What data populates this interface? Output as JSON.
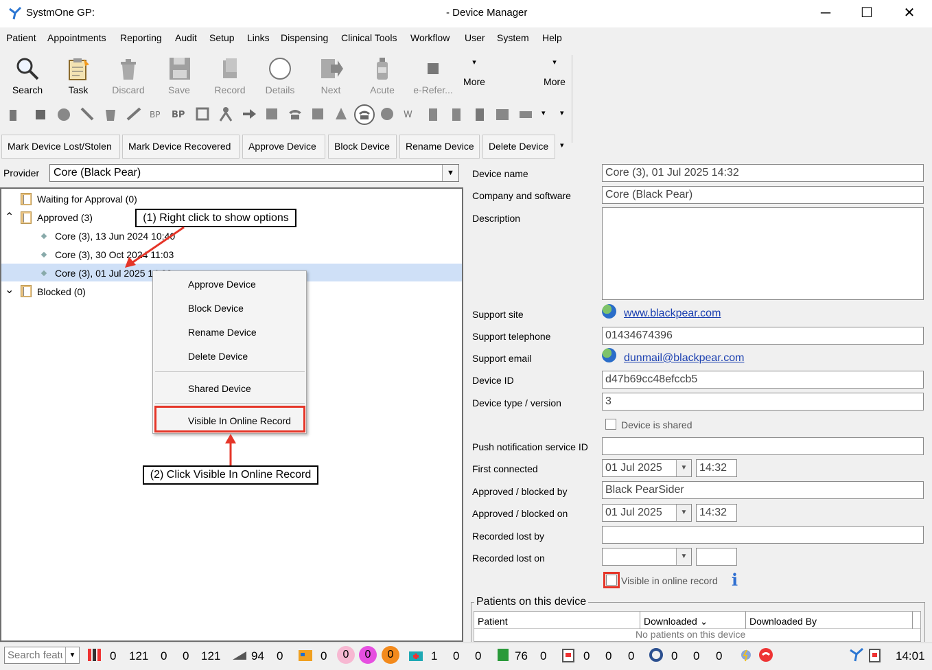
{
  "window": {
    "app_title": "SystmOne GP:",
    "doc_title": "- Device Manager",
    "minimize": "─",
    "maximize": "☐",
    "close": "✕"
  },
  "menu": [
    "Patient",
    "Appointments",
    "Reporting",
    "Audit",
    "Setup",
    "Links",
    "Dispensing",
    "Clinical Tools",
    "Workflow",
    "User",
    "System",
    "Help"
  ],
  "toolbar": {
    "search": "Search",
    "task": "Task",
    "discard": "Discard",
    "save": "Save",
    "record": "Record",
    "details": "Details",
    "next": "Next",
    "acute": "Acute",
    "erefer": "e-Refer...",
    "more1": "More",
    "more2": "More",
    "overflow": "▾"
  },
  "actions": {
    "lost": "Mark Device Lost/Stolen",
    "recovered": "Mark Device Recovered",
    "approve": "Approve Device",
    "block": "Block Device",
    "rename": "Rename Device",
    "delete": "Delete Device",
    "more": "▾"
  },
  "provider": {
    "label": "Provider",
    "value": "Core (Black Pear)",
    "arrow": "▼"
  },
  "tree": {
    "waiting": "Waiting for Approval (0)",
    "approved": "Approved (3)",
    "items": [
      "Core (3), 13 Jun 2024 10:40",
      "Core (3), 30 Oct 2024 11:03",
      "Core (3), 01 Jul 2025 14:32"
    ],
    "blocked": "Blocked (0)",
    "expand": "⌃",
    "collapse": "⌄"
  },
  "context_menu": [
    "Approve Device",
    "Block Device",
    "Rename Device",
    "Delete Device",
    "Shared Device",
    "Visible In Online Record"
  ],
  "callouts": {
    "one": "(1) Right click to show options",
    "two": "(2) Click Visible In Online Record"
  },
  "details": {
    "device_name_label": "Device name",
    "device_name": "Core (3), 01 Jul 2025 14:32",
    "company_label": "Company and software",
    "company": "Core (Black Pear)",
    "description_label": "Description",
    "support_site_label": "Support site",
    "support_site": "www.blackpear.com",
    "support_tel_label": "Support telephone",
    "support_tel": "01434674396",
    "support_email_label": "Support email",
    "support_email": "dunmail@blackpear.com",
    "device_id_label": "Device ID",
    "device_id": "d47b69cc48efccb5",
    "device_type_label": "Device type / version",
    "device_type": "3",
    "shared_label": "Device is shared",
    "push_label": "Push notification service ID",
    "first_connected_label": "First connected",
    "first_connected_date": "01 Jul 2025",
    "first_connected_time": "14:32",
    "approved_by_label": "Approved / blocked by",
    "approved_by": "Black PearSider",
    "approved_on_label": "Approved / blocked on",
    "approved_on_date": "01 Jul 2025",
    "approved_on_time": "14:32",
    "lost_by_label": "Recorded lost by",
    "lost_on_label": "Recorded lost on",
    "visible_label": "Visible in online record",
    "dd_arrow": "▼",
    "info": "i"
  },
  "patients": {
    "legend": "Patients on this device",
    "col_patient": "Patient",
    "col_downloaded": "Downloaded ⌄",
    "col_downloaded_by": "Downloaded By",
    "empty": "No patients on this device"
  },
  "status": {
    "search_placeholder": "Search featu",
    "n1": "0",
    "n2": "121",
    "n3": "0",
    "n4": "0",
    "n5": "121",
    "n6": "94",
    "n7": "0",
    "n8": "0",
    "c1": "0",
    "c2": "0",
    "c3": "0",
    "n9": "1",
    "n10": "0",
    "n11": "0",
    "n12": "76",
    "n13": "0",
    "n14": "0",
    "n15": "0",
    "n16": "0",
    "n17": "0",
    "n18": "0",
    "n19": "0",
    "time": "14:01"
  }
}
